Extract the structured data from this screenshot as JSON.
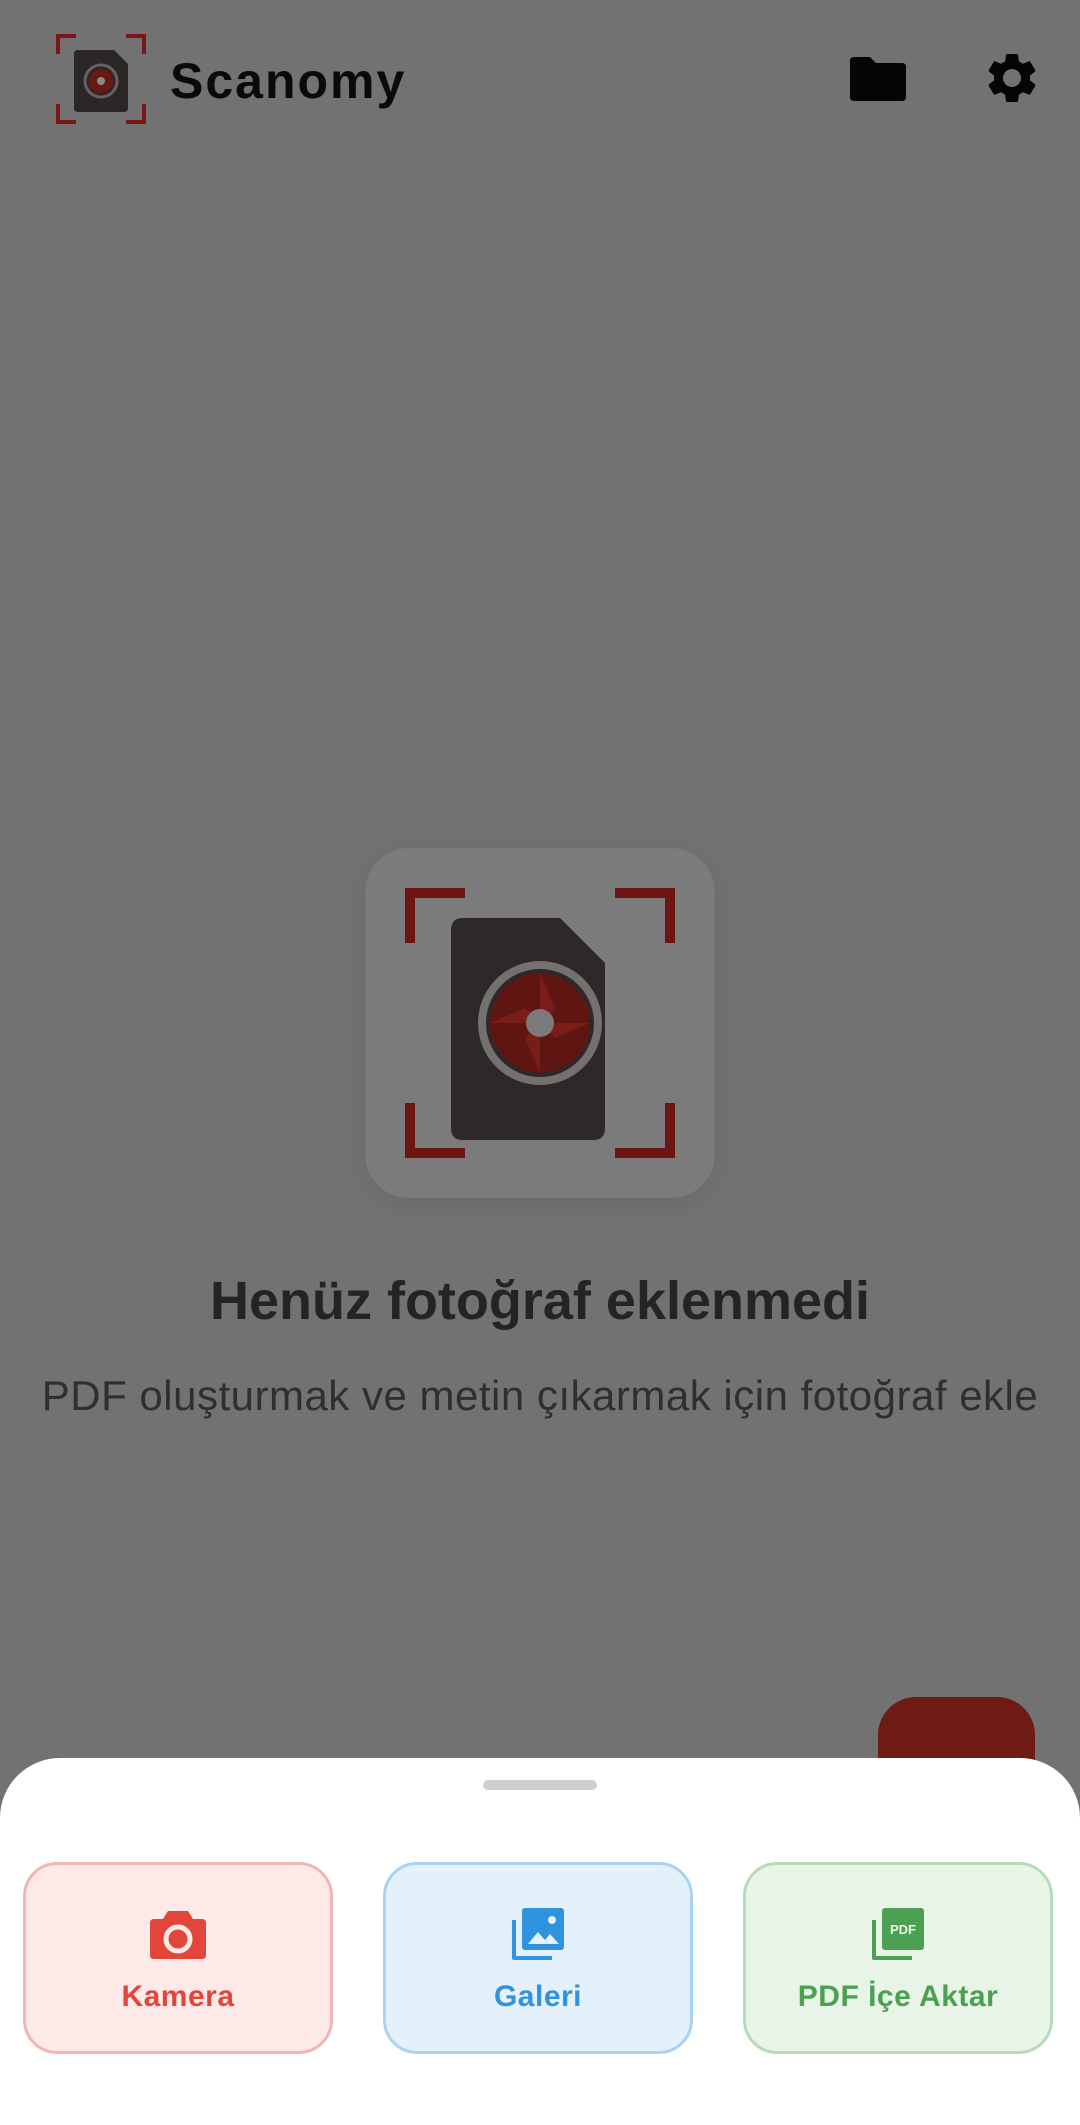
{
  "app": {
    "title": "Scanomy"
  },
  "header": {
    "folder_icon": "folder-icon",
    "settings_icon": "gear-icon"
  },
  "empty_state": {
    "title": "Henüz fotoğraf eklenmedi",
    "subtitle": "PDF oluşturmak ve metin çıkarmak için fotoğraf ekle"
  },
  "sheet": {
    "actions": [
      {
        "label": "Kamera",
        "icon": "camera-icon",
        "color": "#e2463a"
      },
      {
        "label": "Galeri",
        "icon": "gallery-icon",
        "color": "#2f93dd"
      },
      {
        "label": "PDF İçe Aktar",
        "icon": "pdf-icon",
        "color": "#4ba052"
      }
    ]
  },
  "colors": {
    "brand_red": "#8b1a1a",
    "scrim": "#727272",
    "sheet_bg": "#ffffff"
  }
}
